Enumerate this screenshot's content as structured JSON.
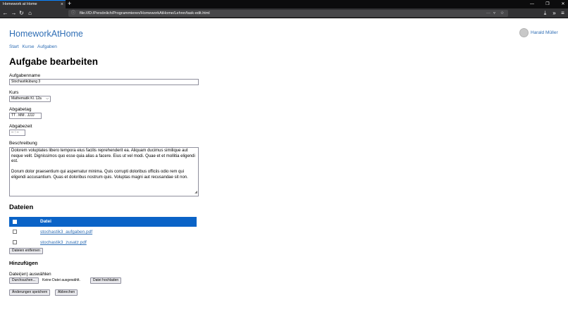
{
  "browser": {
    "tab_title": "Homework at Home",
    "url": "file:///D:/Persönlich/Programmieren/HomeworkAtHome/Lehrer/task-edit.html"
  },
  "site": {
    "brand": "HomeworkAtHome",
    "user_name": "Harald Müller",
    "nav": [
      "Start",
      "Kurse",
      "Aufgaben"
    ]
  },
  "form": {
    "heading": "Aufgabe bearbeiten",
    "task_name_label": "Aufgabenname",
    "task_name_value": "Stochastikübung 3",
    "course_label": "Kurs",
    "course_value": "Mathematik Kl. 12a",
    "due_date_label": "Abgabetag",
    "due_date_placeholder": "TT . MM . JJJJ",
    "due_time_label": "Abgabezeit",
    "due_time_placeholder": "-- : --",
    "description_label": "Beschreibung",
    "description_p1": "Dolorem voluptates libero tempora eius facilis reprehenderit ea. Aliquam ducimus similique aut neque velit. Dignissimos quo esse quia alias a facere. Eius ut vel modi. Quae et et mollitia eligendi est.",
    "description_p2": "Dorum dolor praesentium qui aspernatur minima. Quis corrupti doloribus officiis odio rem qui eligendi accusantium. Quas et doloribus nostrum quis. Voluptas magni aut recusandae sit non."
  },
  "files": {
    "heading": "Dateien",
    "column_header": "Datei",
    "rows": [
      "stochastik3_aufgaben.pdf",
      "stochastik3_zusatz.pdf"
    ],
    "remove_button": "Dateien entfernen"
  },
  "add": {
    "heading": "Hinzufügen",
    "select_label": "Datei(en) auswählen",
    "browse_button": "Durchsuchen...",
    "no_file_text": "Keine Datei ausgewählt.",
    "upload_button": "Datei hochladen"
  },
  "actions": {
    "save_button": "Änderungen speichern",
    "cancel_button": "Abbrechen"
  },
  "colors": {
    "accent": "#0a63c7",
    "link": "#2f6eb5"
  }
}
